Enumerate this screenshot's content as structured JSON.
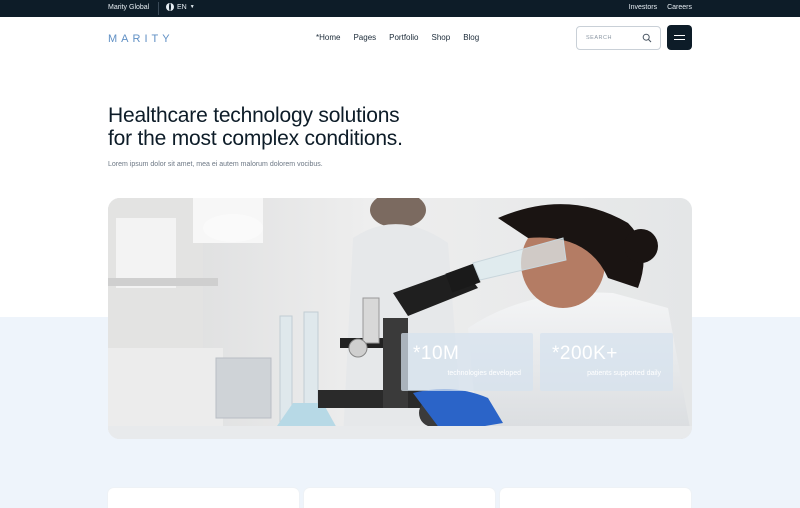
{
  "topbar": {
    "brand": "Marity Global",
    "language": "EN",
    "links": [
      "Investors",
      "Careers"
    ]
  },
  "header": {
    "logo": "MARITY",
    "nav": [
      "*Home",
      "Pages",
      "Portfolio",
      "Shop",
      "Blog"
    ],
    "search_placeholder": "SEARCH"
  },
  "hero": {
    "title_line1": "Healthcare technology solutions",
    "title_line2": "for the most complex conditions.",
    "lead": "Lorem ipsum dolor sit amet, mea ei autem malorum dolorem vocibus."
  },
  "stats": [
    {
      "value": "*10M",
      "label": "technologies developed"
    },
    {
      "value": "*200K+",
      "label": "patients supported daily"
    }
  ],
  "colors": {
    "dark": "#0d1c28",
    "accent": "#5f8fc4",
    "hero_background": "#eef4fb"
  }
}
